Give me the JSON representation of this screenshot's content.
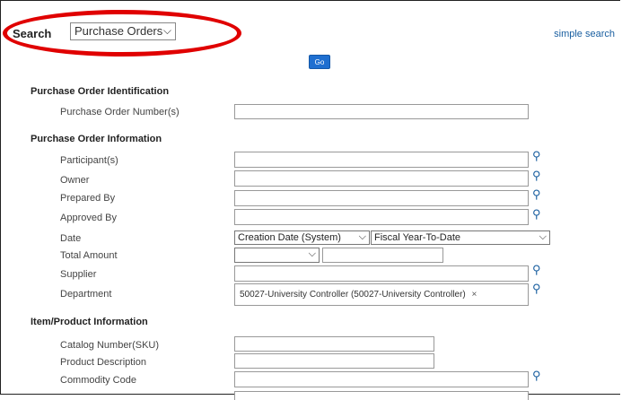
{
  "header": {
    "search_label": "Search",
    "search_select_value": "Purchase Orders",
    "simple_search_link": "simple search",
    "go_button": "Go"
  },
  "sections": {
    "identification": "Purchase Order Identification",
    "information": "Purchase Order Information",
    "item": "Item/Product Information"
  },
  "fields": {
    "po_numbers": "Purchase Order Number(s)",
    "participants": "Participant(s)",
    "owner": "Owner",
    "prepared_by": "Prepared By",
    "approved_by": "Approved By",
    "date": "Date",
    "date_type_value": "Creation Date (System)",
    "date_range_value": "Fiscal Year-To-Date",
    "total_amount": "Total Amount",
    "total_amount_op_value": "",
    "supplier": "Supplier",
    "department": "Department",
    "department_token": "50027-University Controller (50027-University Controller)",
    "token_remove": "×",
    "catalog_number": "Catalog Number(SKU)",
    "product_description": "Product Description",
    "commodity_code": "Commodity Code"
  },
  "icons": {
    "lookup": "magnifier-icon",
    "dropdown": "chevron-down-icon"
  },
  "colors": {
    "highlight": "#e00000",
    "go": "#1f6fd0",
    "link": "#1a5fa0"
  }
}
